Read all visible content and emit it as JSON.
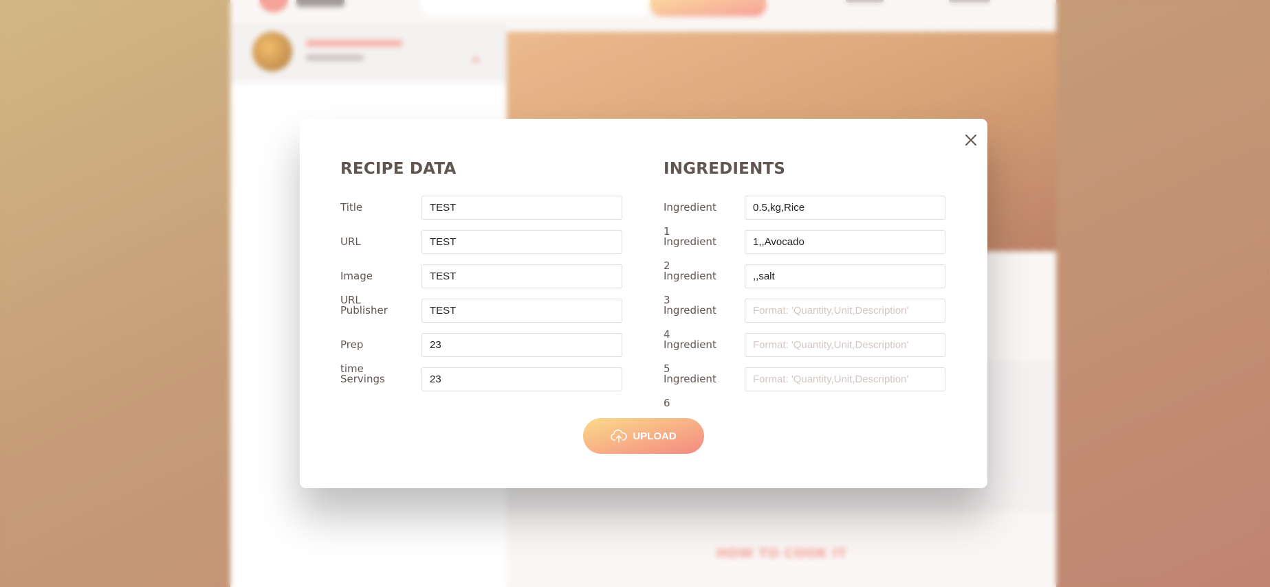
{
  "background": {
    "section_heading": "How to cook it"
  },
  "modal": {
    "close_icon": "close-icon",
    "recipe_data": {
      "heading": "Recipe data",
      "fields": [
        {
          "label": "Title",
          "value": "TEST",
          "placeholder": ""
        },
        {
          "label": "URL",
          "value": "TEST",
          "placeholder": ""
        },
        {
          "label": "Image URL",
          "value": "TEST",
          "placeholder": ""
        },
        {
          "label": "Publisher",
          "value": "TEST",
          "placeholder": ""
        },
        {
          "label": "Prep time",
          "value": "23",
          "placeholder": ""
        },
        {
          "label": "Servings",
          "value": "23",
          "placeholder": ""
        }
      ]
    },
    "ingredients": {
      "heading": "Ingredients",
      "fields": [
        {
          "label": "Ingredient 1",
          "value": "0.5,kg,Rice",
          "placeholder": "Format: 'Quantity,Unit,Description'"
        },
        {
          "label": "Ingredient 2",
          "value": "1,,Avocado",
          "placeholder": "Format: 'Quantity,Unit,Description'"
        },
        {
          "label": "Ingredient 3",
          "value": ",,salt",
          "placeholder": "Format: 'Quantity,Unit,Description'"
        },
        {
          "label": "Ingredient 4",
          "value": "",
          "placeholder": "Format: 'Quantity,Unit,Description'"
        },
        {
          "label": "Ingredient 5",
          "value": "",
          "placeholder": "Format: 'Quantity,Unit,Description'"
        },
        {
          "label": "Ingredient 6",
          "value": "",
          "placeholder": "Format: 'Quantity,Unit,Description'"
        }
      ]
    },
    "upload": {
      "label": "Upload",
      "icon": "upload-cloud-icon"
    }
  },
  "colors": {
    "accent": "#f38e82",
    "gradient_start": "#fbdb89",
    "gradient_end": "#f48982",
    "text": "#615551",
    "placeholder": "#d3c7c3"
  }
}
